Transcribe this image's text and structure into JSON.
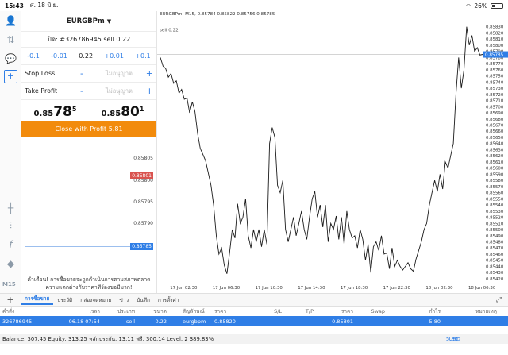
{
  "status_bar": {
    "time": "15:43",
    "date": "ศ. 18 มิ.ย.",
    "battery": "26%",
    "battery_level": 0.26
  },
  "left_toolbar": {
    "icons": [
      "account-icon",
      "quotes-icon",
      "chat-icon",
      "new-order-icon",
      "crosshair-icon",
      "indicators-icon",
      "function-icon",
      "objects-icon"
    ],
    "timeframe": "M15"
  },
  "order_panel": {
    "symbol": "EURGBPm",
    "order_title": "ปิด: #326786945 sell 0.22",
    "volume_steps": [
      "-0.1",
      "-0.01",
      "0.22",
      "+0.01",
      "+0.1"
    ],
    "stop_loss_label": "Stop Loss",
    "take_profit_label": "Take Profit",
    "not_set": "ไม่อนุญาต",
    "minus": "-",
    "plus": "+",
    "bid": {
      "small": "0.85",
      "big": "78",
      "sup": "5"
    },
    "ask": {
      "small": "0.85",
      "big": "80",
      "sup": "1"
    },
    "close_button": "Close with Profit 5.81"
  },
  "mini_chart": {
    "ticks": [
      "0.85805",
      "0.85800",
      "0.85795",
      "0.85790"
    ],
    "ask_tag": "0.85801",
    "bid_tag": "0.85785",
    "ask_color": "#d9534f",
    "bid_color": "#2f7ee6"
  },
  "warning": "คำเตือน! การซื้อขายจะถูกดำเนินการตามสภาพตลาด ความแตกต่างกับราคาที่ร้องขอมีมาก!",
  "main_chart": {
    "header": "EURGBPm, M15, 0.85784 0.85822 0.85756 0.85785",
    "sell_label": "sell 0.22",
    "price_tag": "0.85785",
    "y_ticks": [
      "0.85830",
      "0.85820",
      "0.85810",
      "0.85800",
      "0.85790",
      "0.85780",
      "0.85770",
      "0.85760",
      "0.85750",
      "0.85740",
      "0.85730",
      "0.85720",
      "0.85710",
      "0.85700",
      "0.85690",
      "0.85680",
      "0.85670",
      "0.85660",
      "0.85650",
      "0.85640",
      "0.85630",
      "0.85620",
      "0.85610",
      "0.85600",
      "0.85590",
      "0.85580",
      "0.85570",
      "0.85560",
      "0.85550",
      "0.85540",
      "0.85530",
      "0.85520",
      "0.85510",
      "0.85500",
      "0.85490",
      "0.85480",
      "0.85470",
      "0.85460",
      "0.85450",
      "0.85440",
      "0.85430",
      "0.85420"
    ],
    "x_ticks": [
      "17 Jun 02:30",
      "17 Jun 06:30",
      "17 Jun 10:30",
      "17 Jun 14:30",
      "17 Jun 18:30",
      "17 Jun 22:30",
      "18 Jun 02:30",
      "18 Jun 06:30"
    ],
    "ylim": [
      0.85416,
      0.8584
    ],
    "sell_price": 0.8582,
    "last_price": 0.85785
  },
  "chart_data": {
    "type": "line",
    "title": "EURGBPm, M15, 0.85784 0.85822 0.85756 0.85785",
    "xlabel": "",
    "ylabel": "",
    "x": [
      "17 Jun 00:15",
      "17 Jun 00:30",
      "17 Jun 00:45",
      "17 Jun 01:00",
      "17 Jun 01:15",
      "17 Jun 01:30",
      "17 Jun 01:45",
      "17 Jun 02:00",
      "17 Jun 02:15",
      "17 Jun 02:30",
      "17 Jun 02:45",
      "17 Jun 03:00",
      "17 Jun 03:15",
      "17 Jun 03:30",
      "17 Jun 03:45",
      "17 Jun 04:00",
      "17 Jun 04:15",
      "17 Jun 04:30",
      "17 Jun 04:45",
      "17 Jun 05:00",
      "17 Jun 05:15",
      "17 Jun 05:30",
      "17 Jun 05:45",
      "17 Jun 06:00",
      "17 Jun 06:15",
      "17 Jun 06:30",
      "17 Jun 06:45",
      "17 Jun 07:00",
      "17 Jun 07:15",
      "17 Jun 07:30",
      "17 Jun 07:45",
      "17 Jun 08:00",
      "17 Jun 08:15",
      "17 Jun 08:30",
      "17 Jun 08:45",
      "17 Jun 09:00",
      "17 Jun 09:15",
      "17 Jun 09:30",
      "17 Jun 09:45",
      "17 Jun 10:00",
      "17 Jun 10:15",
      "17 Jun 10:30",
      "17 Jun 10:45",
      "17 Jun 11:00",
      "17 Jun 11:15",
      "17 Jun 11:30",
      "17 Jun 11:45",
      "17 Jun 12:00",
      "17 Jun 12:15",
      "17 Jun 12:30",
      "17 Jun 12:45",
      "17 Jun 13:00",
      "17 Jun 13:15",
      "17 Jun 13:30",
      "17 Jun 13:45",
      "17 Jun 14:00",
      "17 Jun 14:15",
      "17 Jun 14:30",
      "17 Jun 14:45",
      "17 Jun 15:00",
      "17 Jun 15:15",
      "17 Jun 15:30",
      "17 Jun 15:45",
      "17 Jun 16:00",
      "17 Jun 16:15",
      "17 Jun 16:30",
      "17 Jun 16:45",
      "17 Jun 17:00",
      "17 Jun 17:15",
      "17 Jun 17:30",
      "17 Jun 17:45",
      "17 Jun 18:00",
      "17 Jun 18:15",
      "17 Jun 18:30",
      "17 Jun 18:45",
      "17 Jun 19:00",
      "17 Jun 19:15",
      "17 Jun 19:30",
      "17 Jun 19:45",
      "17 Jun 20:00",
      "17 Jun 20:15",
      "17 Jun 20:30",
      "17 Jun 20:45",
      "17 Jun 21:00",
      "17 Jun 21:15",
      "17 Jun 21:30",
      "17 Jun 21:45",
      "17 Jun 22:00",
      "17 Jun 22:15",
      "17 Jun 22:30",
      "17 Jun 22:45",
      "17 Jun 23:00",
      "17 Jun 23:15",
      "17 Jun 23:30",
      "17 Jun 23:45",
      "18 Jun 00:00",
      "18 Jun 00:15",
      "18 Jun 00:30",
      "18 Jun 00:45",
      "18 Jun 01:00",
      "18 Jun 01:15",
      "18 Jun 01:30",
      "18 Jun 01:45",
      "18 Jun 02:00",
      "18 Jun 02:15",
      "18 Jun 02:30",
      "18 Jun 02:45",
      "18 Jun 03:00",
      "18 Jun 03:15",
      "18 Jun 03:30",
      "18 Jun 03:45",
      "18 Jun 04:00",
      "18 Jun 04:15",
      "18 Jun 04:30",
      "18 Jun 04:45",
      "18 Jun 05:00",
      "18 Jun 05:15",
      "18 Jun 05:30",
      "18 Jun 05:45",
      "18 Jun 06:00",
      "18 Jun 06:15",
      "18 Jun 06:30",
      "18 Jun 06:45",
      "18 Jun 07:00"
    ],
    "series": [
      {
        "values": [
          0.8578,
          0.85766,
          0.85762,
          0.85748,
          0.85754,
          0.85738,
          0.85742,
          0.85722,
          0.85728,
          0.85712,
          0.85714,
          0.8569,
          0.85708,
          0.85692,
          0.85656,
          0.85632,
          0.85622,
          0.85612,
          0.85592,
          0.85572,
          0.8554,
          0.8549,
          0.8546,
          0.8547,
          0.85442,
          0.85428,
          0.85462,
          0.855,
          0.85486,
          0.85542,
          0.8551,
          0.8552,
          0.8555,
          0.8549,
          0.8547,
          0.855,
          0.8548,
          0.855,
          0.85472,
          0.855,
          0.85476,
          0.8564,
          0.85666,
          0.8565,
          0.85572,
          0.8556,
          0.8558,
          0.855,
          0.8548,
          0.855,
          0.8552,
          0.8549,
          0.8551,
          0.8553,
          0.855,
          0.85484,
          0.8552,
          0.8555,
          0.85562,
          0.8552,
          0.8554,
          0.85504,
          0.8554,
          0.8548,
          0.8551,
          0.855,
          0.85522,
          0.85484,
          0.8552,
          0.85476,
          0.8553,
          0.855,
          0.85486,
          0.8549,
          0.8547,
          0.855,
          0.85484,
          0.8545,
          0.85476,
          0.8543,
          0.85472,
          0.8548,
          0.85466,
          0.8549,
          0.8546,
          0.85462,
          0.85436,
          0.8547,
          0.8544,
          0.8545,
          0.8544,
          0.85434,
          0.8544,
          0.85446,
          0.85436,
          0.85432,
          0.85452,
          0.85466,
          0.8548,
          0.855,
          0.8551,
          0.8554,
          0.8556,
          0.8558,
          0.85562,
          0.8559,
          0.85566,
          0.8561,
          0.856,
          0.8562,
          0.8564,
          0.8572,
          0.8578,
          0.8573,
          0.8576,
          0.8583,
          0.858,
          0.85816,
          0.8579,
          0.85796,
          0.85784,
          0.85785
        ]
      }
    ],
    "ylim": [
      0.85416,
      0.8584
    ],
    "grid": false,
    "legend": "none"
  },
  "tabs": {
    "add": "+",
    "items": [
      "การซื้อขาย",
      "ประวัติ",
      "กล่องจดหมาย",
      "ข่าว",
      "บันทึก",
      "การตั้งค่า"
    ],
    "active": 0
  },
  "table": {
    "headers": [
      "คำสั่ง",
      "เวลา",
      "ประเภท",
      "ขนาด",
      "สัญลักษณ์",
      "ราคา",
      "S/L",
      "T/P",
      "ราคา",
      "Swap",
      "กำไร",
      "หมายเหตุ"
    ],
    "rows": [
      [
        "326786945",
        "06.18 07:54",
        "sell",
        "0.22",
        "eurgbpm",
        "0.85820",
        "",
        "",
        "0.85801",
        "",
        "5.80",
        ""
      ]
    ]
  },
  "balance": {
    "text": "Balance: 307.45 Equity: 313.25 หลักประกัน: 13.11 ฟรี: 300.14 Level: 2 389.83%",
    "profit": "5.80",
    "currency": "USD"
  }
}
